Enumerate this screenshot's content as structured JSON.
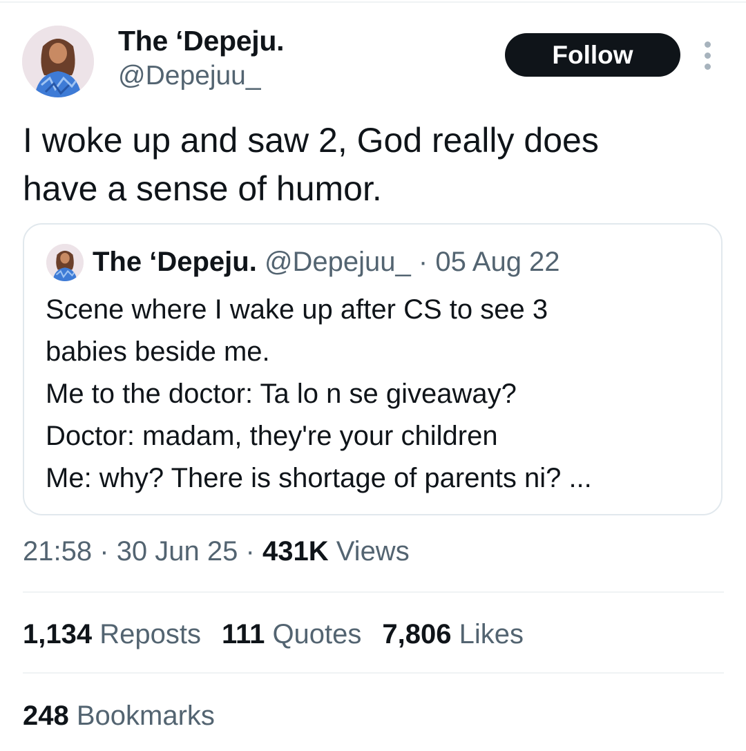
{
  "author": {
    "display_name": "The ‘Depeju.",
    "handle": "@Depejuu_",
    "avatar_icon": "profile-photo"
  },
  "follow_label": "Follow",
  "more_icon": "more-vertical-icon",
  "tweet": {
    "lines": [
      "I woke up and saw 2, God really does",
      "have a sense of humor."
    ]
  },
  "quote": {
    "display_name": "The ‘Depeju.",
    "handle": "@Depejuu_",
    "separator": "·",
    "date": "05 Aug 22",
    "lines": [
      "Scene where I wake up after CS to see 3",
      "babies beside me.",
      "Me to the doctor: Ta lo n se giveaway?",
      "Doctor: madam, they're your children",
      "Me: why? There is shortage of parents ni? ..."
    ]
  },
  "meta": {
    "time": "21:58",
    "separator": "·",
    "date": "30 Jun 25",
    "views_count": "431K",
    "views_label": "Views"
  },
  "stats": {
    "reposts_count": "1,134",
    "reposts_label": "Reposts",
    "quotes_count": "111",
    "quotes_label": "Quotes",
    "likes_count": "7,806",
    "likes_label": "Likes",
    "bookmarks_count": "248",
    "bookmarks_label": "Bookmarks"
  },
  "colors": {
    "text": "#0f1419",
    "secondary": "#536471",
    "border": "#e1e8ed",
    "follow_bg": "#0f1419"
  }
}
